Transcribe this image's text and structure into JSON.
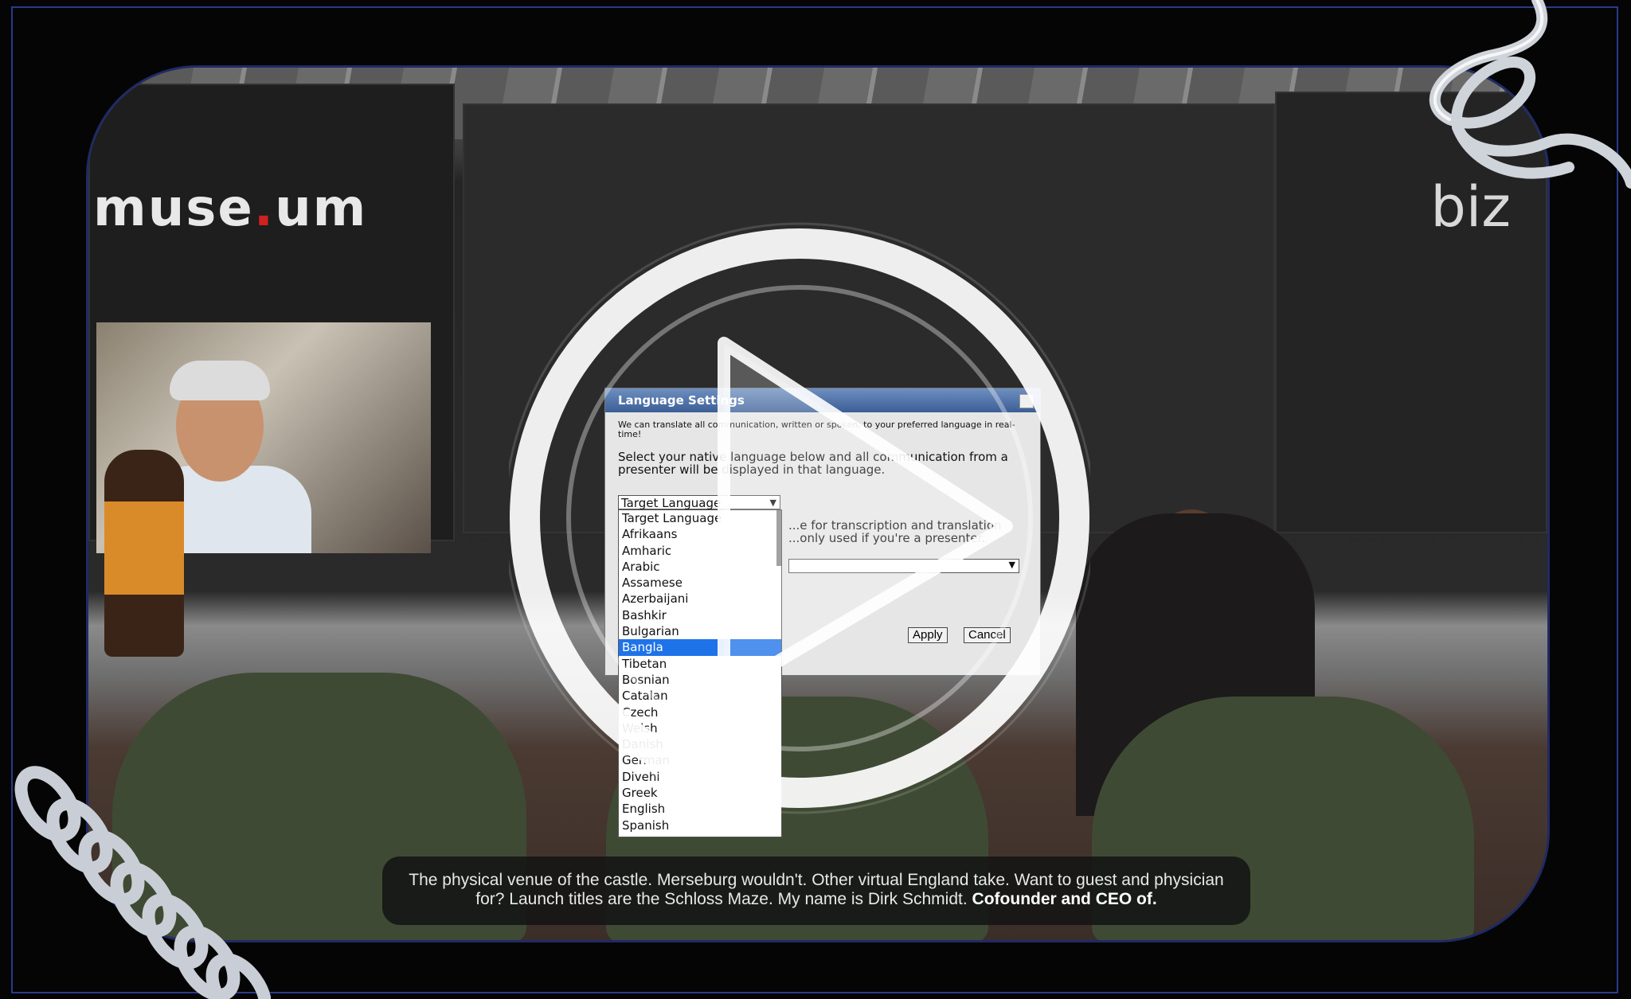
{
  "scene": {
    "left_logo": "muse.um",
    "right_logo": "biz"
  },
  "dialog": {
    "title": "Language Settings",
    "intro": "We can translate all communication, written or spoken, to your preferred language in real-time!",
    "body": "Select your native language below and all communication from a presenter will be displayed in that language.",
    "target_select_value": "Target Language",
    "aux_text": "...e for transcription and translation ...only used if you're a presenter.",
    "apply_label": "Apply",
    "cancel_label": "Cancel"
  },
  "language_list": {
    "options": [
      "Target Language",
      "Afrikaans",
      "Amharic",
      "Arabic",
      "Assamese",
      "Azerbaijani",
      "Bashkir",
      "Bulgarian",
      "Bangla",
      "Tibetan",
      "Bosnian",
      "Catalan",
      "Czech",
      "Welsh",
      "Danish",
      "German",
      "Divehi",
      "Greek",
      "English",
      "Spanish"
    ],
    "selected": "Bangla"
  },
  "caption": {
    "text": "The physical venue of the castle. Merseburg wouldn't. Other virtual England take. Want to guest and physician for? Launch titles are the Schloss Maze. My name is Dirk Schmidt.",
    "bold": "Cofounder and CEO of."
  },
  "colors": {
    "selection": "#1e73e8",
    "frame": "#2a3a8a",
    "title_bar": "#3b5e96"
  }
}
